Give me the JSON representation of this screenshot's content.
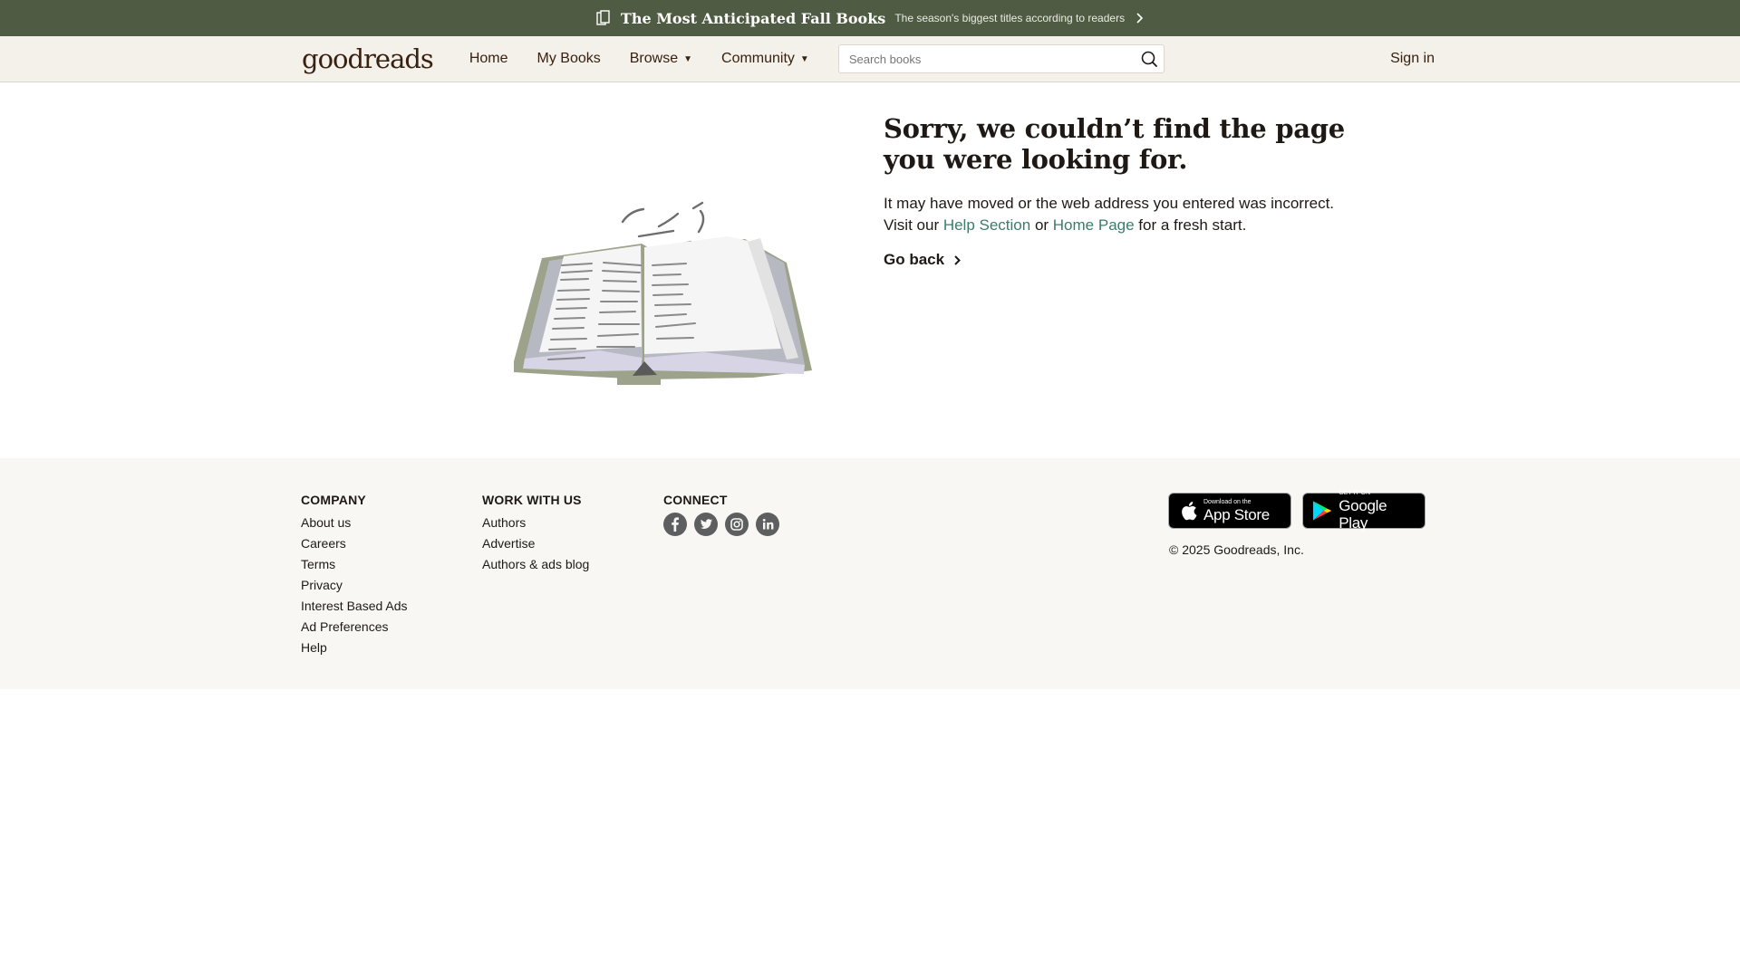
{
  "promo": {
    "title": "The Most Anticipated Fall Books",
    "subtitle": "The season's biggest titles according to readers"
  },
  "header": {
    "logo": "goodreads",
    "nav": {
      "home": "Home",
      "my_books": "My Books",
      "browse": "Browse",
      "community": "Community"
    },
    "caret": "▼",
    "search_placeholder": "Search books",
    "sign_in": "Sign in"
  },
  "main": {
    "heading": "Sorry, we couldn’t find the page you were looking for.",
    "body_prefix": "It may have moved or the web address you entered was incorrect. Visit our ",
    "help_link": "Help Section",
    "body_or": " or ",
    "home_link": "Home Page",
    "body_suffix": " for a fresh start.",
    "go_back": "Go back"
  },
  "footer": {
    "company": {
      "heading": "COMPANY",
      "links": [
        "About us",
        "Careers",
        "Terms",
        "Privacy",
        "Interest Based Ads",
        "Ad Preferences",
        "Help"
      ]
    },
    "work": {
      "heading": "WORK WITH US",
      "links": [
        "Authors",
        "Advertise",
        "Authors & ads blog"
      ]
    },
    "connect": {
      "heading": "CONNECT",
      "icons": [
        "facebook-icon",
        "twitter-icon",
        "instagram-icon",
        "linkedin-icon"
      ]
    },
    "app_store": {
      "small": "Download on the",
      "big": "App Store"
    },
    "google_play": {
      "small": "GET IT ON",
      "big": "Google Play"
    },
    "copyright": "© 2025 Goodreads, Inc."
  },
  "colors": {
    "banner": "#4f5b42",
    "header_bg": "#f4f1ea",
    "link": "#3d7b6b",
    "footer_bg": "#f9f7f4"
  }
}
